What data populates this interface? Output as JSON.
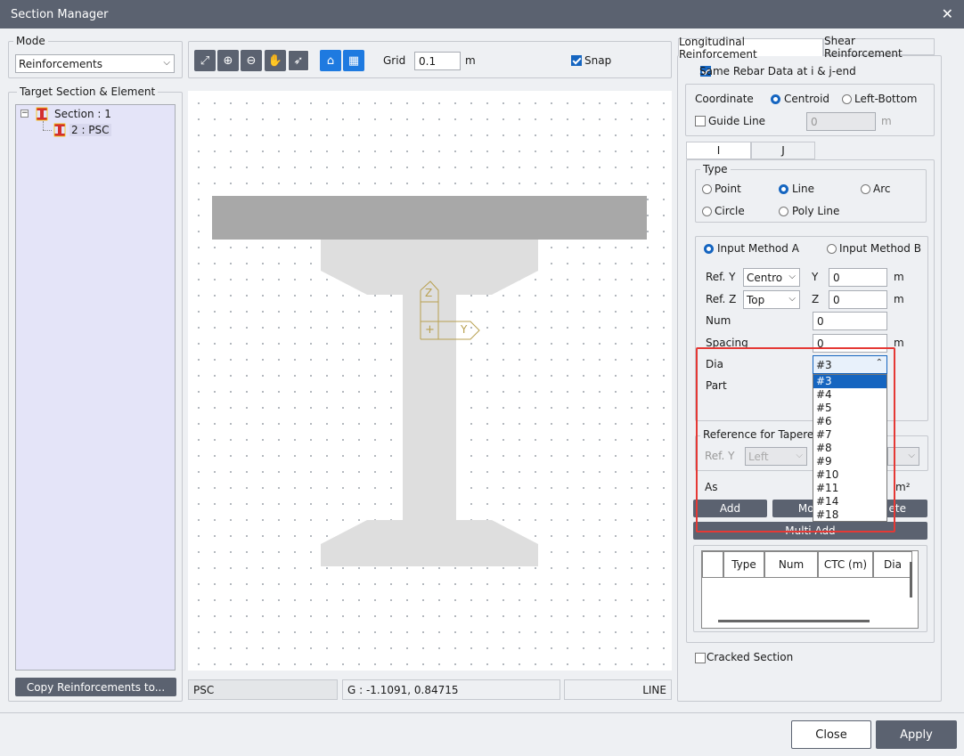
{
  "window": {
    "title": "Section Manager"
  },
  "mode": {
    "label": "Mode",
    "value": "Reinforcements"
  },
  "target": {
    "label": "Target Section & Element",
    "tree": [
      {
        "label": "Section : 1"
      },
      {
        "label": "2 : PSC"
      }
    ],
    "copy_button": "Copy Reinforcements to..."
  },
  "toolbar": {
    "grid_label": "Grid",
    "grid_value": "0.1",
    "grid_unit": "m",
    "snap_label": "Snap"
  },
  "canvas": {
    "axis_z": "Z",
    "axis_y": "Y",
    "origin": "+"
  },
  "status": {
    "section": "PSC",
    "coords": "G : -1.1091, 0.84715",
    "mode": "LINE"
  },
  "tabs": [
    "Longitudinal Reinforcement",
    "Shear Reinforcement"
  ],
  "panel": {
    "same_rebar": "Same Rebar Data at i & j-end",
    "coordinate_label": "Coordinate",
    "centroid": "Centroid",
    "left_bottom": "Left-Bottom",
    "guide_line": "Guide Line",
    "guide_value": "0",
    "guide_unit": "m",
    "end_tabs": [
      "I",
      "J"
    ],
    "type_label": "Type",
    "types": [
      "Point",
      "Line",
      "Arc",
      "Circle",
      "Poly Line"
    ],
    "method_a": "Input Method A",
    "method_b": "Input Method B",
    "ref_y_label": "Ref. Y",
    "ref_y_value": "Centro",
    "y_label": "Y",
    "y_value": "0",
    "ref_z_label": "Ref. Z",
    "ref_z_value": "Top",
    "z_label": "Z",
    "z_value": "0",
    "unit_m": "m",
    "num_label": "Num",
    "num_value": "0",
    "spacing_label": "Spacing",
    "spacing_value": "0",
    "dia_label": "Dia",
    "dia_value": "#3",
    "part_label": "Part",
    "tapered_label": "Reference for Tapered",
    "tapered_ref_y": "Ref. Y",
    "tapered_ref_value": "Left",
    "as_label": "As",
    "as_unit": "m²",
    "add_button": "Add",
    "modify_button": "Mod",
    "delete_button": "ete",
    "multi_add_button": "Multi Add",
    "table_headers": [
      "Type",
      "Num",
      "CTC (m)",
      "Dia"
    ],
    "cracked": "Cracked Section"
  },
  "dia_options": [
    "#3",
    "#4",
    "#5",
    "#6",
    "#7",
    "#8",
    "#9",
    "#10",
    "#11",
    "#14",
    "#18"
  ],
  "footer": {
    "close": "Close",
    "apply": "Apply"
  }
}
